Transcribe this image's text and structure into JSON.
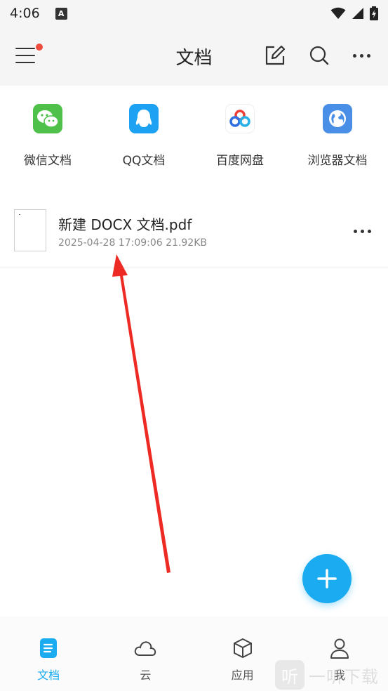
{
  "status_bar": {
    "time": "4:06",
    "notification_glyph": "A",
    "icons": [
      "wifi-icon",
      "signal-icon",
      "battery-charging-icon"
    ]
  },
  "app_bar": {
    "title": "文档",
    "has_notification_dot": true,
    "actions": [
      "edit-icon",
      "search-icon",
      "more-icon"
    ]
  },
  "sources": [
    {
      "label": "微信文档",
      "icon": "wechat-icon",
      "color": "#4fc14a"
    },
    {
      "label": "QQ文档",
      "icon": "qq-icon",
      "color": "#1da1f2"
    },
    {
      "label": "百度网盘",
      "icon": "baidu-netdisk-icon",
      "color": "#ffffff"
    },
    {
      "label": "浏览器文档",
      "icon": "browser-icon",
      "color": "#4a8fe7"
    }
  ],
  "files": [
    {
      "name": "新建 DOCX 文档.pdf",
      "meta": "2025-04-28 17:09:06 21.92KB"
    }
  ],
  "fab": {
    "icon": "plus-icon",
    "color": "#1aabf0"
  },
  "bottom_nav": [
    {
      "label": "文档",
      "icon": "document-icon",
      "active": true
    },
    {
      "label": "云",
      "icon": "cloud-icon",
      "active": false
    },
    {
      "label": "应用",
      "icon": "apps-cube-icon",
      "active": false
    },
    {
      "label": "我",
      "icon": "profile-icon",
      "active": false
    }
  ],
  "watermark": {
    "glyph": "听",
    "text": "一听下载"
  },
  "colors": {
    "accent": "#1aabf0",
    "annotation_arrow": "#ee2a24"
  }
}
